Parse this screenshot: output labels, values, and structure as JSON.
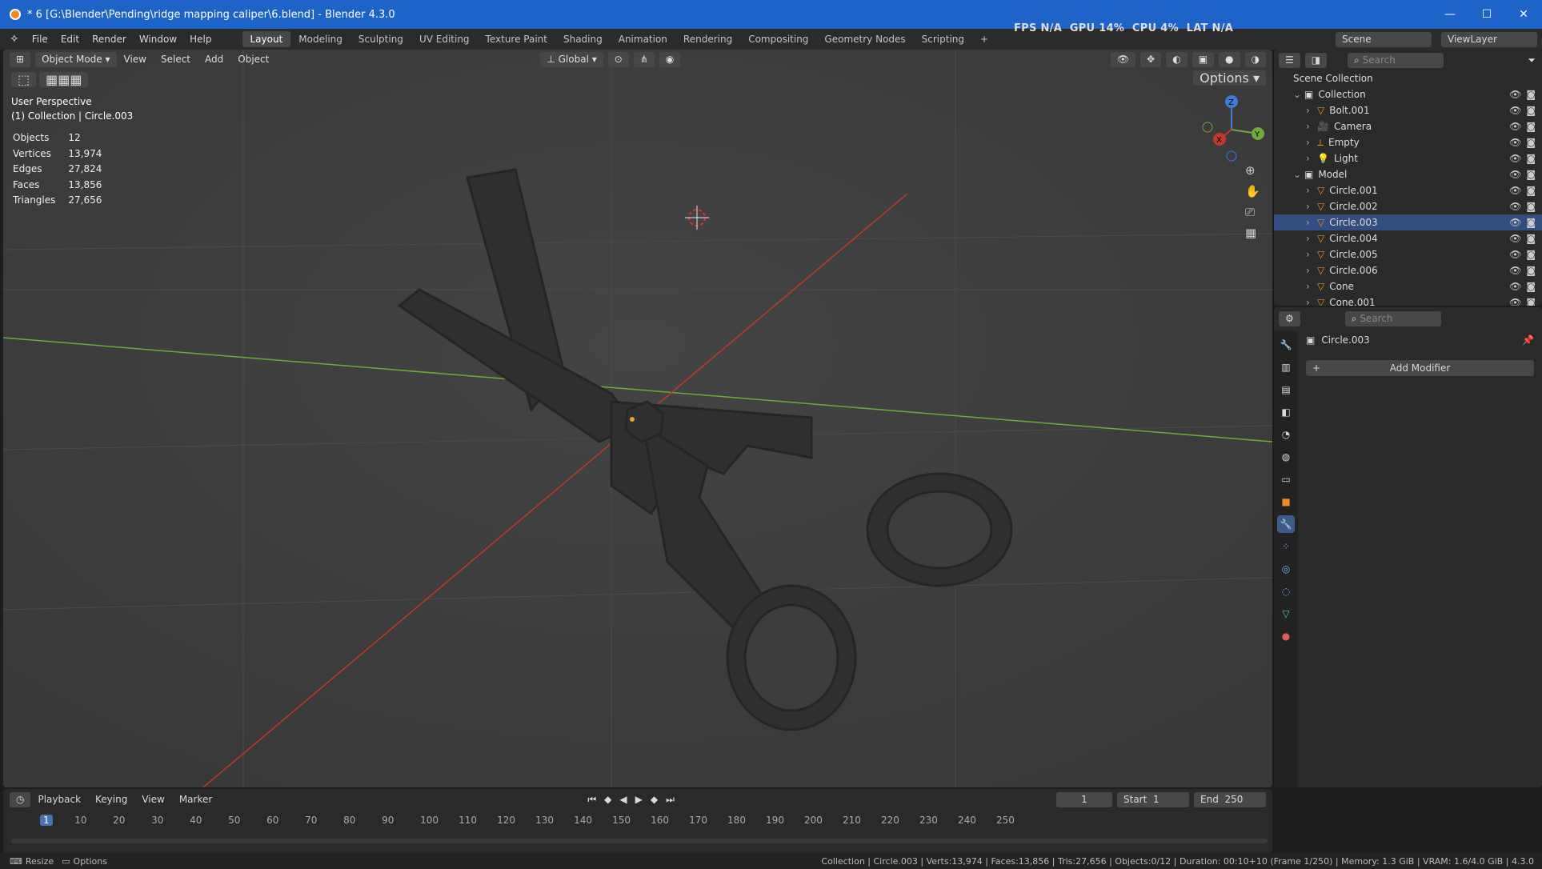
{
  "window": {
    "title": "* 6 [G:\\Blender\\Pending\\ridge mapping caliper\\6.blend] - Blender 4.3.0",
    "min": "—",
    "max": "☐",
    "close": "✕"
  },
  "menu": [
    "File",
    "Edit",
    "Render",
    "Window",
    "Help"
  ],
  "workspaces": [
    "Layout",
    "Modeling",
    "Sculpting",
    "UV Editing",
    "Texture Paint",
    "Shading",
    "Animation",
    "Rendering",
    "Compositing",
    "Geometry Nodes",
    "Scripting"
  ],
  "active_workspace": "Layout",
  "perf": {
    "fps_label": "FPS",
    "fps": "N/A",
    "gpu_label": "GPU",
    "gpu": "14%",
    "cpu_label": "CPU",
    "cpu": "4%",
    "lat_label": "LAT",
    "lat": "N/A"
  },
  "scene": {
    "scene_name": "Scene",
    "view_layer": "ViewLayer"
  },
  "viewport": {
    "mode": "Object Mode",
    "menus": [
      "View",
      "Select",
      "Add",
      "Object"
    ],
    "orientation": "Global",
    "options": "Options",
    "perspective": "User Perspective",
    "context": "(1) Collection | Circle.003",
    "stats": [
      [
        "Objects",
        "12"
      ],
      [
        "Vertices",
        "13,974"
      ],
      [
        "Edges",
        "27,824"
      ],
      [
        "Faces",
        "13,856"
      ],
      [
        "Triangles",
        "27,656"
      ]
    ],
    "gizmo": {
      "x": "X",
      "y": "Y",
      "z": "Z"
    }
  },
  "outliner": {
    "search_placeholder": "Search",
    "root": "Scene Collection",
    "rows": [
      {
        "label": "Collection",
        "level": 1,
        "type": "collection"
      },
      {
        "label": "Bolt.001",
        "level": 2,
        "type": "mesh"
      },
      {
        "label": "Camera",
        "level": 2,
        "type": "camera"
      },
      {
        "label": "Empty",
        "level": 2,
        "type": "empty"
      },
      {
        "label": "Light",
        "level": 2,
        "type": "light"
      },
      {
        "label": "Model",
        "level": 1,
        "type": "collection"
      },
      {
        "label": "Circle.001",
        "level": 2,
        "type": "mesh"
      },
      {
        "label": "Circle.002",
        "level": 2,
        "type": "mesh"
      },
      {
        "label": "Circle.003",
        "level": 2,
        "type": "mesh",
        "selected": true
      },
      {
        "label": "Circle.004",
        "level": 2,
        "type": "mesh"
      },
      {
        "label": "Circle.005",
        "level": 2,
        "type": "mesh"
      },
      {
        "label": "Circle.006",
        "level": 2,
        "type": "mesh"
      },
      {
        "label": "Cone",
        "level": 2,
        "type": "mesh"
      },
      {
        "label": "Cone.001",
        "level": 2,
        "type": "mesh"
      }
    ]
  },
  "properties": {
    "search_placeholder": "Search",
    "object": "Circle.003",
    "add_modifier": "Add Modifier"
  },
  "timeline": {
    "menus": [
      "Playback",
      "Keying",
      "View",
      "Marker"
    ],
    "current_frame": "1",
    "start_label": "Start",
    "start": "1",
    "end_label": "End",
    "end": "250",
    "ticks": [
      "1",
      "10",
      "20",
      "30",
      "40",
      "50",
      "60",
      "70",
      "80",
      "90",
      "100",
      "110",
      "120",
      "130",
      "140",
      "150",
      "160",
      "170",
      "180",
      "190",
      "200",
      "210",
      "220",
      "230",
      "240",
      "250"
    ]
  },
  "status": {
    "left1": "Resize",
    "left2": "Options",
    "right": "Collection | Circle.003 | Verts:13,974 | Faces:13,856 | Tris:27,656 | Objects:0/12 | Duration: 00:10+10 (Frame 1/250) | Memory: 1.3 GiB | VRAM: 1.6/4.0 GiB | 4.3.0"
  },
  "colors": {
    "accent": "#1e63c8",
    "selection": "#334d80",
    "x_axis": "#c0392b",
    "y_axis": "#6ea93c",
    "z_axis": "#3b7dd8"
  }
}
